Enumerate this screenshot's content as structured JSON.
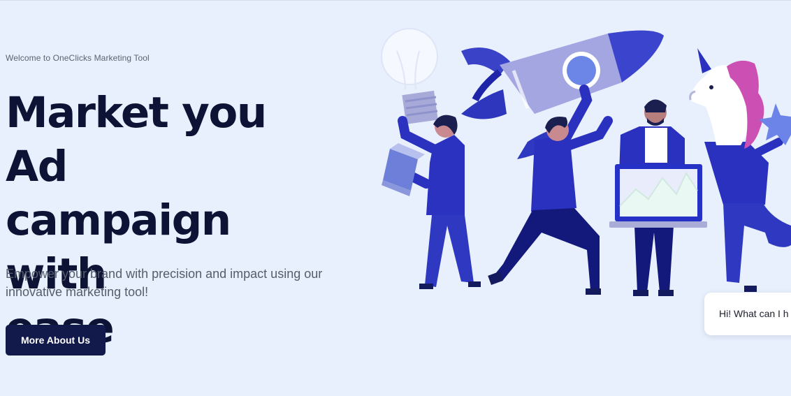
{
  "hero": {
    "eyebrow": "Welcome to OneClicks Marketing Tool",
    "title_line1": "Market you Ad",
    "title_line2": "campaign with",
    "title_line3": "ease",
    "subtitle_line1": "Empower your brand with precision and impact using our",
    "subtitle_line2": "innovative marketing tool!",
    "cta_label": "More About Us"
  },
  "chat": {
    "message": "Hi! What can I h"
  },
  "colors": {
    "background": "#e8f0fd",
    "heading": "#0d1335",
    "button": "#111a4a",
    "illustration_primary": "#2730c4",
    "illustration_accent": "#c94fb6"
  },
  "illustration": {
    "icons": [
      "lightbulb-icon",
      "rocket-icon",
      "unicorn-head-icon",
      "star-icon",
      "laptop-chart-icon",
      "cube-icon"
    ]
  }
}
